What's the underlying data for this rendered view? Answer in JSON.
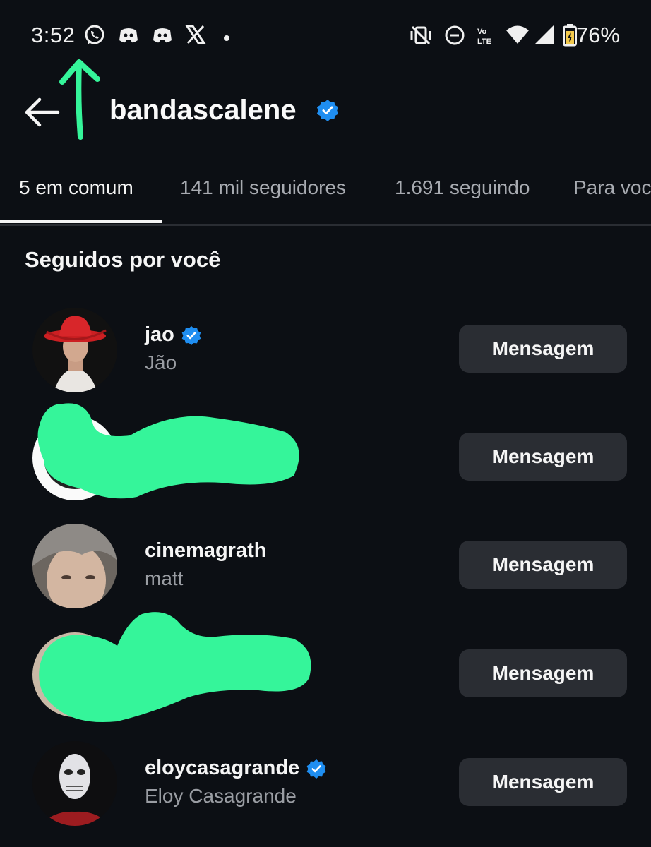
{
  "status_bar": {
    "time": "3:52",
    "battery": "76%",
    "icons": [
      "whatsapp-icon",
      "discord-icon",
      "discord-icon",
      "x-icon",
      "dot-icon",
      "vibrate-off-icon",
      "do-not-disturb-icon",
      "volte-icon",
      "wifi-icon",
      "signal-icon",
      "battery-icon"
    ]
  },
  "header": {
    "title": "bandascalene",
    "verified": true
  },
  "tabs": [
    {
      "label": "5 em comum",
      "active": true
    },
    {
      "label": "141 mil seguidores",
      "active": false
    },
    {
      "label": "1.691 seguindo",
      "active": false
    },
    {
      "label": "Para você",
      "active": false
    }
  ],
  "section": {
    "heading": "Seguidos por você"
  },
  "users": [
    {
      "username": "jao",
      "display_name": "Jão",
      "verified": true,
      "button": "Mensagem",
      "redacted": false
    },
    {
      "username": "",
      "display_name": "",
      "verified": false,
      "button": "Mensagem",
      "redacted": true
    },
    {
      "username": "cinemagrath",
      "display_name": "matt",
      "verified": false,
      "button": "Mensagem",
      "redacted": false
    },
    {
      "username": "",
      "display_name": "",
      "verified": false,
      "button": "Mensagem",
      "redacted": true
    },
    {
      "username": "eloycasagrande",
      "display_name": "Eloy Casagrande",
      "verified": true,
      "button": "Mensagem",
      "redacted": false
    }
  ],
  "colors": {
    "background": "#0c0f14",
    "button": "#2a2d33",
    "verified": "#1f8ef1",
    "annotation": "#35f59a"
  }
}
